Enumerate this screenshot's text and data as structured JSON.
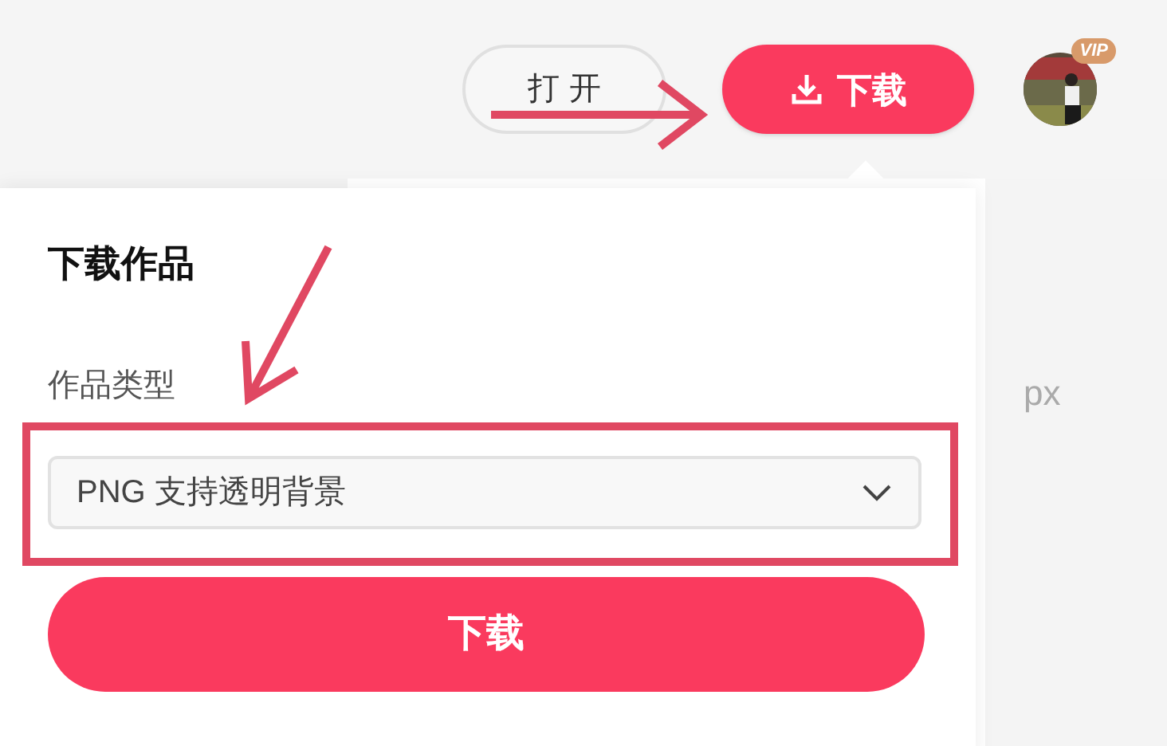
{
  "top_bar": {
    "open_button": "打 开",
    "download_button": "下载",
    "avatar": {
      "badge": "VIP"
    }
  },
  "background": {
    "unit": "px"
  },
  "download_popup": {
    "title": "下载作品",
    "field_label": "作品类型",
    "file_type": {
      "value": "PNG 支持透明背景"
    },
    "download_button": "下载"
  }
}
